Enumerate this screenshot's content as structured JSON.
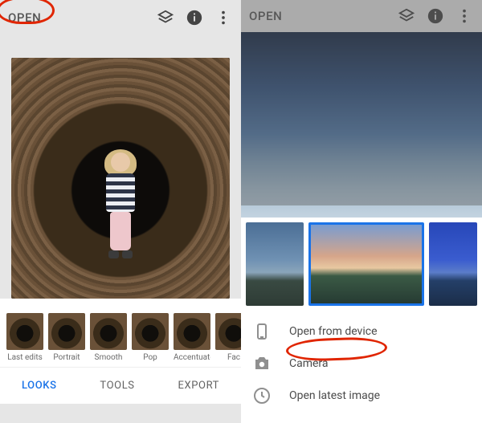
{
  "left": {
    "open_label": "OPEN",
    "looks": [
      {
        "label": "Last edits"
      },
      {
        "label": "Portrait"
      },
      {
        "label": "Smooth"
      },
      {
        "label": "Pop"
      },
      {
        "label": "Accentuate"
      },
      {
        "label": "Fac"
      }
    ],
    "tabs": {
      "looks": "LOOKS",
      "tools": "TOOLS",
      "export": "EXPORT"
    }
  },
  "right": {
    "open_label": "OPEN",
    "options": {
      "open_from_device": "Open from device",
      "camera": "Camera",
      "open_latest": "Open latest image"
    }
  },
  "colors": {
    "accent": "#1a73e8",
    "annotation": "#e02500"
  }
}
